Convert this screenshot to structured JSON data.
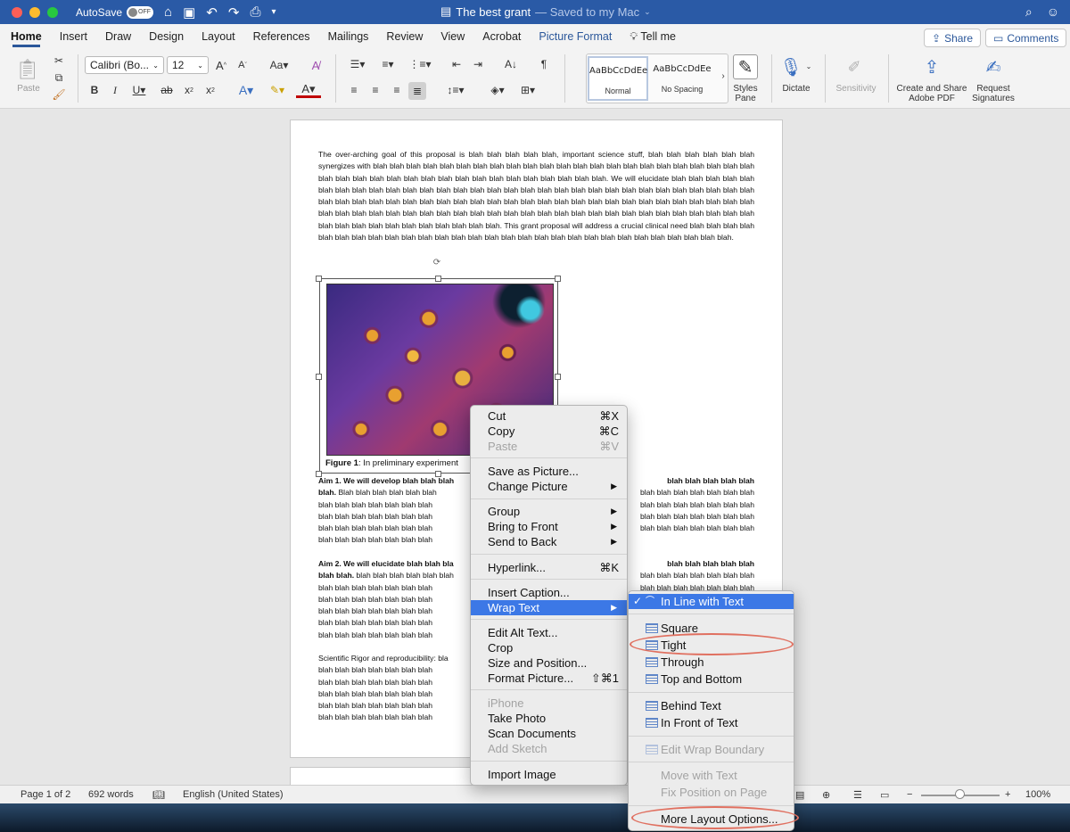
{
  "titlebar": {
    "autosave_label": "AutoSave",
    "autosave_state": "OFF",
    "doc_title": "The best grant",
    "saved_status": "— Saved to my Mac"
  },
  "tabs": [
    {
      "label": "Home"
    },
    {
      "label": "Insert"
    },
    {
      "label": "Draw"
    },
    {
      "label": "Design"
    },
    {
      "label": "Layout"
    },
    {
      "label": "References"
    },
    {
      "label": "Mailings"
    },
    {
      "label": "Review"
    },
    {
      "label": "View"
    },
    {
      "label": "Acrobat"
    },
    {
      "label": "Picture Format"
    },
    {
      "label": "Tell me"
    }
  ],
  "header_buttons": {
    "share": "Share",
    "comments": "Comments"
  },
  "ribbon": {
    "paste": "Paste",
    "font_name": "Calibri (Bo...",
    "font_size": "12",
    "style_normal_preview": "AaBbCcDdEe",
    "style_normal": "Normal",
    "style_nospacing_preview": "AaBbCcDdEe",
    "style_nospacing": "No Spacing",
    "styles_pane": "Styles Pane",
    "dictate": "Dictate",
    "sensitivity": "Sensitivity",
    "create_share": "Create and Share Adobe PDF",
    "request_sig": "Request Signatures"
  },
  "document": {
    "intro": "The over-arching goal of this proposal is blah blah blah blah blah, important science stuff, blah blah blah blah blah blah synergizes with blah blah blah blah blah blah blah blah blah blah blah blah blah blah blah blah blah blah blah blah blah blah blah blah blah blah blah blah blah blah blah blah blah blah blah blah blah blah blah blah. We will elucidate blah blah blah blah blah blah blah blah blah blah blah blah blah blah blah blah blah blah blah blah blah blah blah blah blah blah blah blah blah blah blah blah blah blah blah blah blah blah blah blah blah blah blah blah blah blah blah blah blah blah blah blah blah blah blah blah blah blah blah blah blah blah blah blah blah blah blah blah blah blah blah blah blah blah blah blah blah blah blah blah blah blah blah blah blah blah blah blah blah blah blah blah blah blah. This grant proposal will address a crucial clinical need blah blah blah blah blah blah blah blah blah blah blah blah blah blah blah blah blah blah blah blah blah blah blah blah blah blah blah blah blah.",
    "caption_label": "Figure 1",
    "caption_text": ": In preliminary experiment",
    "aim1_bold_a": "Aim 1. We will develop blah blah blah",
    "aim1_bold_b": "blah blah blah blah blah",
    "aim1_bold_c": "blah.",
    "aim1_body_a": "Blah blah blah blah blah blah",
    "aim1_line": "blah blah blah blah blah blah blah",
    "aim2_bold_a": "Aim 2. We will elucidate blah blah bla",
    "aim2_bold_b": "blah blah blah blah blah",
    "aim2_bold_c": "blah blah.",
    "aim2_body_a": "blah blah blah blah blah blah",
    "aim2_line": "blah blah blah blah blah blah blah",
    "rigor_a": "Scientific Rigor and reproducibility: bla",
    "rigor_line": "blah blah blah blah blah blah blah"
  },
  "context_menu": {
    "cut": "Cut",
    "cut_sc": "⌘X",
    "copy": "Copy",
    "copy_sc": "⌘C",
    "paste": "Paste",
    "paste_sc": "⌘V",
    "save_as_picture": "Save as Picture...",
    "change_picture": "Change Picture",
    "group": "Group",
    "bring_to_front": "Bring to Front",
    "send_to_back": "Send to Back",
    "hyperlink": "Hyperlink...",
    "hyperlink_sc": "⌘K",
    "insert_caption": "Insert Caption...",
    "wrap_text": "Wrap Text",
    "edit_alt_text": "Edit Alt Text...",
    "crop": "Crop",
    "size_position": "Size and Position...",
    "format_picture": "Format Picture...",
    "format_picture_sc": "⇧⌘1",
    "iphone": "iPhone",
    "take_photo": "Take Photo",
    "scan_documents": "Scan Documents",
    "add_sketch": "Add Sketch",
    "import_image": "Import Image"
  },
  "wrap_submenu": {
    "inline": "In Line with Text",
    "square": "Square",
    "tight": "Tight",
    "through": "Through",
    "top_bottom": "Top and Bottom",
    "behind": "Behind Text",
    "front": "In Front of Text",
    "edit_boundary": "Edit Wrap Boundary",
    "move_with": "Move with Text",
    "fix_position": "Fix Position on Page",
    "more_layout": "More Layout Options..."
  },
  "statusbar": {
    "page": "Page 1 of 2",
    "words": "692 words",
    "language": "English (United States)",
    "zoom": "100%"
  },
  "colors": {
    "titlebar": "#2a5aa6",
    "accent": "#2b579a",
    "highlight": "#3c78e6",
    "annotation": "#e07060"
  }
}
